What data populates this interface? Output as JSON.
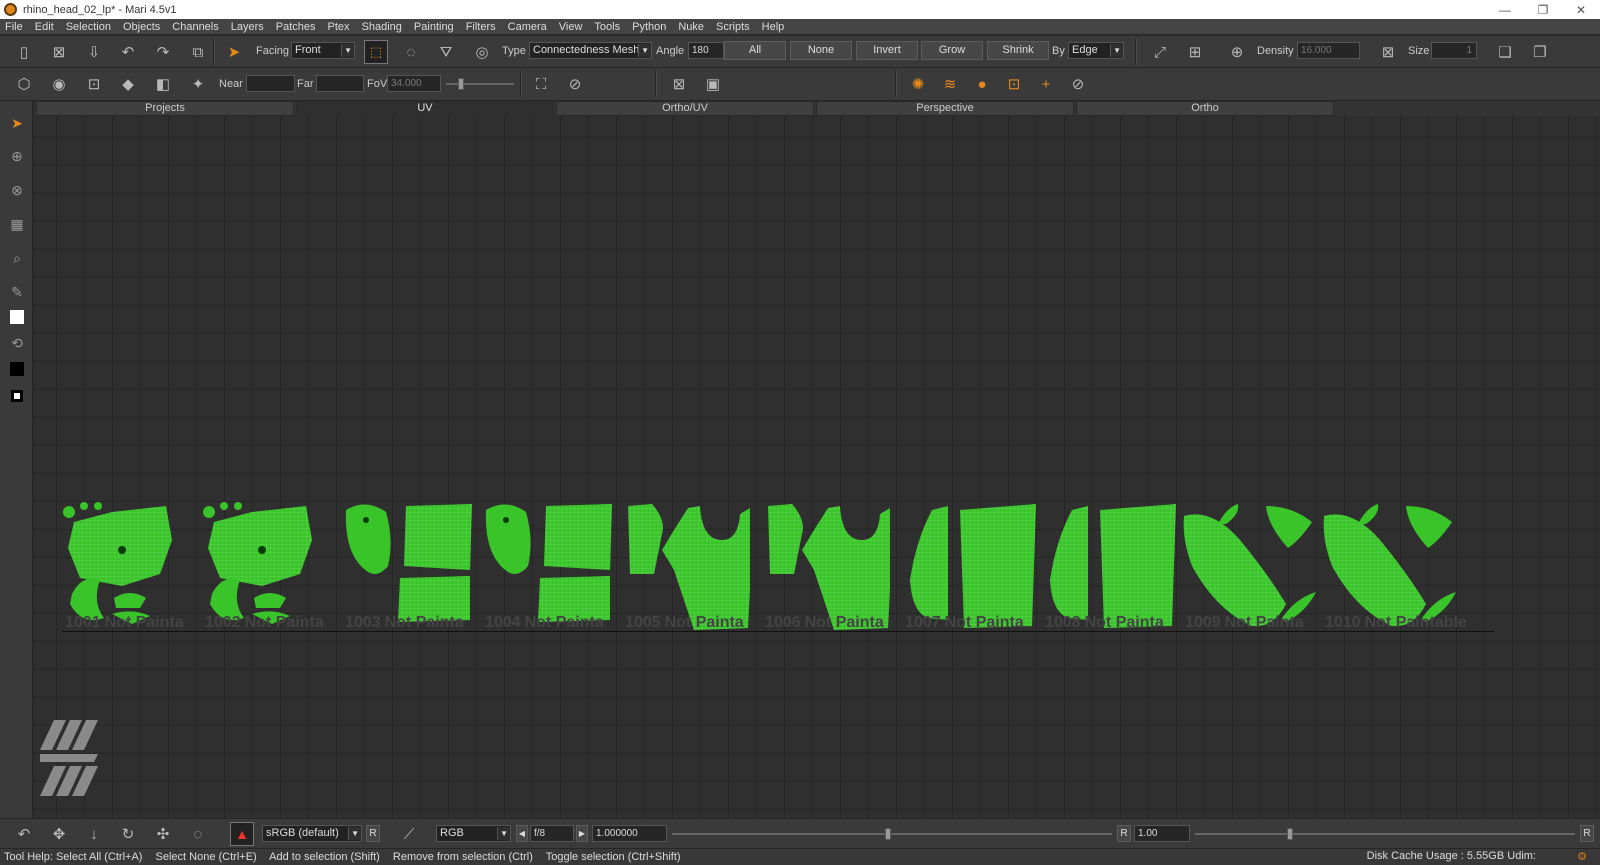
{
  "window": {
    "title": "rhino_head_02_lp* - Mari 4.5v1",
    "controls": [
      "—",
      "❐",
      "✕"
    ]
  },
  "menu": [
    "File",
    "Edit",
    "Selection",
    "Objects",
    "Channels",
    "Layers",
    "Patches",
    "Ptex",
    "Shading",
    "Painting",
    "Filters",
    "Camera",
    "View",
    "Tools",
    "Python",
    "Nuke",
    "Scripts",
    "Help"
  ],
  "toolbar1": {
    "facing_label": "Facing",
    "facing_value": "Front",
    "type_label": "Type",
    "type_value": "Connectedness Mesh",
    "angle_label": "Angle",
    "angle_value": "180",
    "buttons": [
      "All",
      "None",
      "Invert",
      "Grow",
      "Shrink"
    ],
    "by_label": "By",
    "by_value": "Edge",
    "density_label": "Density",
    "density_value": "16.000",
    "size_label": "Size",
    "size_value": "1"
  },
  "toolbar2": {
    "near_label": "Near",
    "near_value": "",
    "far_label": "Far",
    "far_value": "",
    "fov_label": "FoV",
    "fov_value": "34.000",
    "fov_fraction": 0.22
  },
  "tabs": [
    {
      "label": "Projects",
      "active": false
    },
    {
      "label": "UV",
      "active": true
    },
    {
      "label": "Ortho/UV",
      "active": false
    },
    {
      "label": "Perspective",
      "active": false
    },
    {
      "label": "Ortho",
      "active": false
    }
  ],
  "udims": [
    {
      "id": "1001",
      "status": "Not Painta"
    },
    {
      "id": "1002",
      "status": "Not Painta"
    },
    {
      "id": "1003",
      "status": "Not Painta"
    },
    {
      "id": "1004",
      "status": "Not Painta"
    },
    {
      "id": "1005",
      "status": "Not Painta"
    },
    {
      "id": "1006",
      "status": "Not Painta"
    },
    {
      "id": "1007",
      "status": "Not Painta"
    },
    {
      "id": "1008",
      "status": "Not Painta"
    },
    {
      "id": "1009",
      "status": "Not Painta"
    },
    {
      "id": "1010",
      "status": "Not Paintable"
    }
  ],
  "colors": {
    "uv_patch": "#39c42a",
    "uv_patch_dark": "#1f8c15",
    "accent": "#e48a1c",
    "grid_major": "#1c1c1c"
  },
  "bottom": {
    "colorspace_value": "sRGB (default)",
    "colorspace_r": "R",
    "channel_value": "RGB",
    "fstop_value": "f/8",
    "exposure_value": "1.000000",
    "gamma_label": "R",
    "gamma_value": "1.00",
    "exposure_fraction": 0.49,
    "gamma_fraction": 0.25,
    "end_label": "R"
  },
  "status": {
    "hints": [
      "Tool Help: Select All (Ctrl+A)",
      "Select None (Ctrl+E)",
      "Add to selection (Shift)",
      "Remove from selection (Ctrl)",
      "Toggle selection (Ctrl+Shift)"
    ],
    "disk_cache": "Disk Cache Usage : 5.55GB",
    "udim_label": "Udim:"
  }
}
